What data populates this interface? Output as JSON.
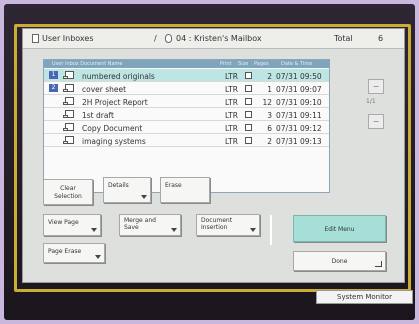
{
  "header": {
    "title": "User Inboxes",
    "separator": "/",
    "mailbox": "04 : Kristen's Mailbox",
    "total_label": "Total",
    "total_count": "6"
  },
  "list": {
    "columns": [
      "User Inbox Document Name",
      "Print",
      "Size",
      "Pages",
      "Date & Time"
    ],
    "rows": [
      {
        "num": "1",
        "name": "numbered originals",
        "type": "LTR",
        "pages": "2",
        "datetime": "07/31 09:50",
        "selected": true
      },
      {
        "num": "2",
        "name": "cover sheet",
        "type": "LTR",
        "pages": "1",
        "datetime": "07/31 09:07",
        "selected": false
      },
      {
        "num": "",
        "name": "2H Project Report",
        "type": "LTR",
        "pages": "12",
        "datetime": "07/31 09:10",
        "selected": false
      },
      {
        "num": "",
        "name": "1st draft",
        "type": "LTR",
        "pages": "3",
        "datetime": "07/31 09:11",
        "selected": false
      },
      {
        "num": "",
        "name": "Copy Document",
        "type": "LTR",
        "pages": "6",
        "datetime": "07/31 09:12",
        "selected": false
      },
      {
        "num": "",
        "name": "imaging systems",
        "type": "LTR",
        "pages": "2",
        "datetime": "07/31 09:13",
        "selected": false
      }
    ]
  },
  "pager": {
    "up": "−",
    "down": "−",
    "count": "1/1"
  },
  "buttons": {
    "clear_selection_1": "Clear",
    "clear_selection_2": "Selection",
    "details": "Details",
    "erase": "Erase",
    "view_page": "View Page",
    "merge_1": "Merge and",
    "merge_2": "Save",
    "insertion_1": "Document",
    "insertion_2": "Insertion",
    "page_erase": "Page Erase",
    "edit_menu": "Edit Menu",
    "done": "Done"
  },
  "system_monitor": "System Monitor"
}
